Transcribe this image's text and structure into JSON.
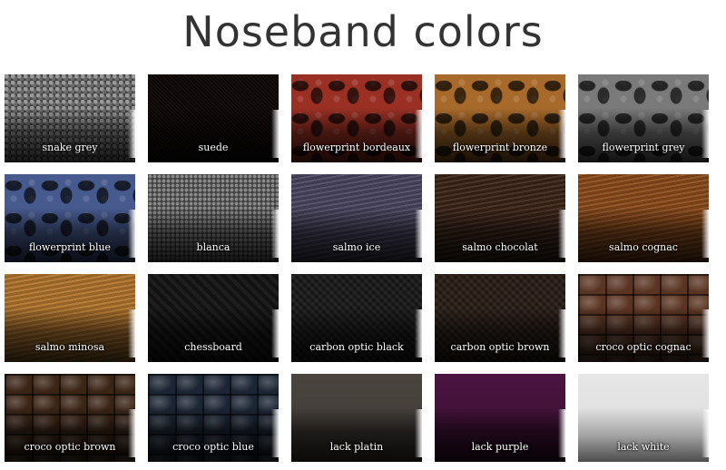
{
  "title": "Noseband colors",
  "swatches": [
    {
      "label": "snake grey"
    },
    {
      "label": "suede"
    },
    {
      "label": "flowerprint bordeaux"
    },
    {
      "label": "flowerprint bronze"
    },
    {
      "label": "flowerprint grey"
    },
    {
      "label": "flowerprint blue"
    },
    {
      "label": "blanca"
    },
    {
      "label": "salmo ice"
    },
    {
      "label": "salmo chocolat"
    },
    {
      "label": "salmo cognac"
    },
    {
      "label": "salmo minosa"
    },
    {
      "label": "chessboard"
    },
    {
      "label": "carbon optic black"
    },
    {
      "label": "carbon optic brown"
    },
    {
      "label": "croco optic cognac"
    },
    {
      "label": "croco optic brown"
    },
    {
      "label": "croco optic blue"
    },
    {
      "label": "lack platin"
    },
    {
      "label": "lack purple"
    },
    {
      "label": "lack white"
    }
  ]
}
